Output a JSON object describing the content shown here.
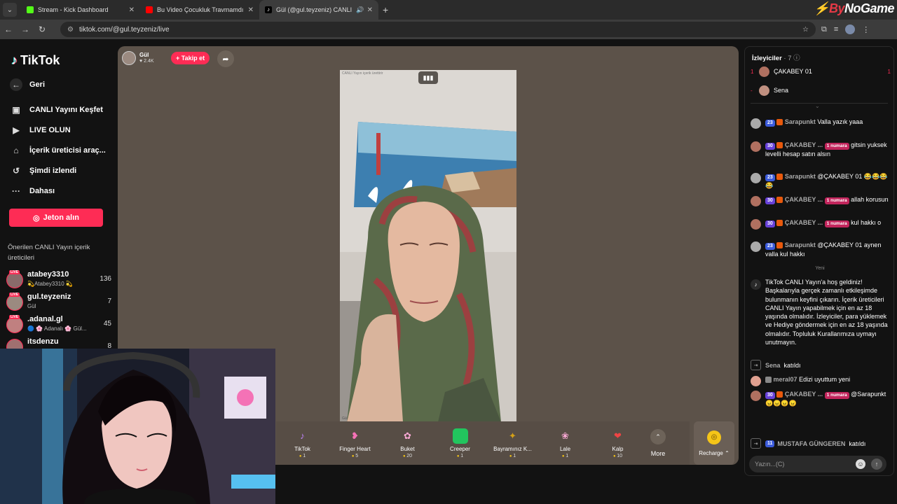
{
  "browser": {
    "tabs": [
      {
        "title": "Stream - Kick Dashboard",
        "color": "#53fc18"
      },
      {
        "title": "Bu Video Çocukluk Travmamdı",
        "color": "#ff0000"
      },
      {
        "title": "Gül (@gul.teyzeniz) CANLI",
        "color": "#222222"
      }
    ],
    "url": "tiktok.com/@gul.teyzeniz/live",
    "brand_a": "By",
    "brand_b": "NoGame"
  },
  "sidebar": {
    "logo": "TikTok",
    "back": "Geri",
    "nav": [
      "CANLI Yayını Keşfet",
      "LIVE OLUN",
      "İçerik üreticisi araç...",
      "Şimdi izlendi",
      "Dahası"
    ],
    "jeton": "Jeton alın",
    "suggested_title": "Önerilen CANLI Yayın içerik üreticileri",
    "live_badge": "LIVE",
    "suggested": [
      {
        "name": "atabey3310",
        "sub": "💫Atabey3310 💫",
        "count": "136"
      },
      {
        "name": "gul.teyzeniz",
        "sub": "Gül",
        "count": "7"
      },
      {
        "name": ".adanal.gl",
        "sub": "🔵 🌸 Adanalı 🌸 Gül...",
        "count": "45"
      },
      {
        "name": "itsdenzu",
        "sub": "",
        "count": "8"
      }
    ]
  },
  "stage": {
    "host_name": "Gül",
    "host_likes": "♥ 2.4K",
    "follow": "+ Takip et",
    "watermark": "CANLI Yayın içerik ürettirir",
    "watermark_bottom": "Gül",
    "gifts": [
      {
        "name": "TikTok",
        "price": "1",
        "icon": "♪",
        "color": "#c084fc"
      },
      {
        "name": "Finger Heart",
        "price": "5",
        "icon": "🫰",
        "color": "#f472b6"
      },
      {
        "name": "Buket",
        "price": "20",
        "icon": "💐",
        "color": "#f9a8d4"
      },
      {
        "name": "Creeper",
        "price": "1",
        "icon": "▦",
        "color": "#22c55e"
      },
      {
        "name": "Bayramınız K...",
        "price": "1",
        "icon": "✦",
        "color": "#d4a017"
      },
      {
        "name": "Lale",
        "price": "1",
        "icon": "🌷",
        "color": "#f9a8d4"
      },
      {
        "name": "Kalp",
        "price": "10",
        "icon": "❤",
        "color": "#ef4444"
      }
    ],
    "more": "More",
    "recharge": "Recharge ⌃"
  },
  "chat": {
    "viewers_title": "İzleyiciler",
    "viewers_count": "· 7",
    "viewers": [
      {
        "rank": "1",
        "name": "ÇAKABEY 01",
        "count": "1"
      },
      {
        "rank": "-",
        "name": "Sena",
        "count": ""
      }
    ],
    "messages": [
      {
        "lv": "23",
        "user": "Sarapunkt",
        "rank": "",
        "text": "Valla yazık yaaa"
      },
      {
        "lv": "30",
        "user": "ÇAKABEY ...",
        "rank": "1 numara",
        "text": "gitsin yuksek levelli hesap satın alsın"
      },
      {
        "lv": "23",
        "user": "Sarapunkt",
        "rank": "",
        "text": "@ÇAKABEY 01 😂😂😂😂"
      },
      {
        "lv": "30",
        "user": "ÇAKABEY ...",
        "rank": "1 numara",
        "text": "allah korusun"
      },
      {
        "lv": "30",
        "user": "ÇAKABEY ...",
        "rank": "1 numara",
        "text": "kul hakkı o"
      },
      {
        "lv": "23",
        "user": "Sarapunkt",
        "rank": "",
        "text": "@ÇAKABEY 01 aynen valla kul hakkı"
      }
    ],
    "new_label": "Yeni",
    "welcome": "TikTok CANLI Yayın'a hoş geldiniz! Başkalarıyla gerçek zamanlı etkileşimde bulunmanın keyfini çıkarın. İçerik üreticileri CANLI Yayın yapabilmek için en az 18 yaşında olmalıdır. İzleyiciler, para yüklemek ve Hediye göndermek için en az 18 yaşında olmalıdır. Topluluk Kurallarımıza uymayı unutmayın.",
    "join1_user": "Sena",
    "join1_text": "katıldı",
    "msg_meral_user": "meral07",
    "msg_meral_text": "Edizi uyuttum yeni",
    "msg_last": {
      "lv": "30",
      "user": "ÇAKABEY ...",
      "rank": "1 numara",
      "text": "@Sarapunkt 😠😠😠😠"
    },
    "join2_lv": "11",
    "join2_user": "MUSTAFA GÜNGEREN",
    "join2_text": "katıldı",
    "input_placeholder": "Yazın...(C)"
  }
}
